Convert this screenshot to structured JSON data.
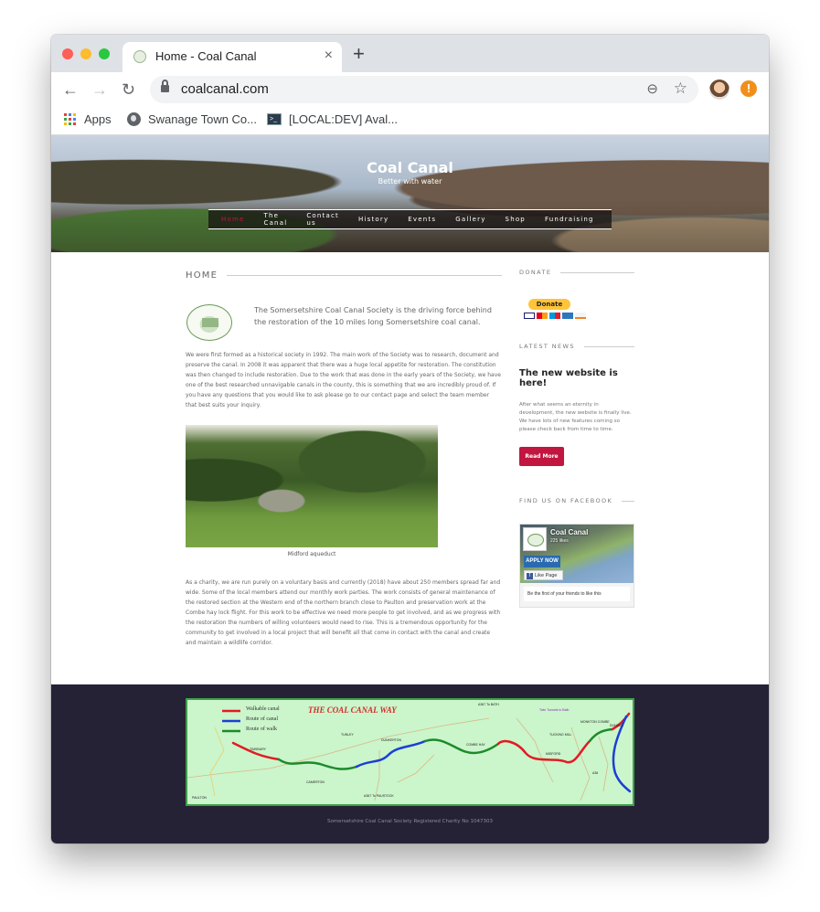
{
  "browser": {
    "tab": {
      "title": "Home - Coal Canal",
      "favicon": "coal-canal-logo"
    },
    "new_tab_label": "+",
    "close_label": "×",
    "url": "coalcanal.com",
    "icons": {
      "back": "←",
      "forward": "→",
      "reload": "↻",
      "zoom": "⊖",
      "bookmark_star": "☆",
      "alert": "!"
    },
    "bookmarks": [
      {
        "label": "Apps",
        "icon": "apps-grid-icon"
      },
      {
        "label": "Swanage Town Co...",
        "icon": "globe-icon"
      },
      {
        "label": "[LOCAL:DEV] Aval...",
        "icon": "terminal-icon"
      }
    ]
  },
  "site": {
    "title": "Coal Canal",
    "tagline": "Better with water",
    "accent_color": "#c1163f",
    "nav": [
      {
        "label": "Home",
        "active": true
      },
      {
        "label": "The Canal",
        "active": false
      },
      {
        "label": "Contact us",
        "active": false
      },
      {
        "label": "History",
        "active": false
      },
      {
        "label": "Events",
        "active": false
      },
      {
        "label": "Gallery",
        "active": false
      },
      {
        "label": "Shop",
        "active": false
      },
      {
        "label": "Fundraising",
        "active": false
      }
    ]
  },
  "main": {
    "heading": "HOME",
    "intro": "The Somersetshire Coal Canal Society is the driving force behind the restoration of the 10 miles long Somersetshire coal canal.",
    "paragraph1": "We were first formed as a historical society in 1992. The main work of the Society was to research, document and preserve the canal. In 2008 it was apparent that there was a huge local appetite for restoration. The constitution was then changed to include restoration. Due to the work that was done in the early years of the Society, we have one of the best researched unnavigable canals in the county, this is something that we are incredibly proud of. If you have any questions that you would like to ask please go to our contact page and select the team member that best suits your inquiry.",
    "photo_caption": "Midford aqueduct",
    "paragraph2": "As a charity, we are run purely on a voluntary basis and currently (2018) have about 250 members spread far and wide. Some of the local members attend our monthly work parties. The work consists of general maintenance of the restored section at the Western end of the northern branch close to Paulton and preservation work at the Combe hay lock flight. For this work to be effective we need more people to get involved, and as we progress with the restoration the numbers of willing volunteers would need to rise. This is a tremendous opportunity for the community to get involved in a local project that will benefit all that come in contact with the canal and create and maintain a wildlife corridor."
  },
  "sidebar": {
    "donate": {
      "heading": "DONATE",
      "button": "Donate",
      "cards": [
        "visa",
        "mastercard",
        "maestro",
        "amex",
        "discover"
      ]
    },
    "news": {
      "heading": "LATEST NEWS",
      "title": "The new website is here!",
      "body": "After what seems an eternity in development, the new website is finally live. We have lots of new features coming so please check back from time to time.",
      "button": "Read More"
    },
    "facebook": {
      "heading": "FIND US ON FACEBOOK",
      "page_name": "Coal Canal",
      "likes": "225 likes",
      "cover_text": "APPLY NOW",
      "like_button": "Like Page",
      "friends_text": "Be the first of your friends to like this"
    }
  },
  "footer": {
    "map": {
      "title": "THE COAL CANAL WAY",
      "legend": [
        {
          "label": "Walkable canal",
          "color": "#e21b23"
        },
        {
          "label": "Route of canal",
          "color": "#1b3fd6"
        },
        {
          "label": "Route of walk",
          "color": "#1d8a2a"
        }
      ],
      "places": [
        "TIMSBURY",
        "TUNLEY",
        "DUNKERTON",
        "CAMERTON",
        "PAULTON",
        "A367 To PAUSTOCK",
        "A367 To BATH",
        "COMBE HAY",
        "Twin Tunnels to Bath",
        "TUCKING MILL",
        "MIDFORD",
        "MONKTON COMBE",
        "DUNDAS",
        "A36"
      ]
    },
    "charity_text": "Somersetshire Coal Canal Society Registered Charity No 1047303"
  }
}
